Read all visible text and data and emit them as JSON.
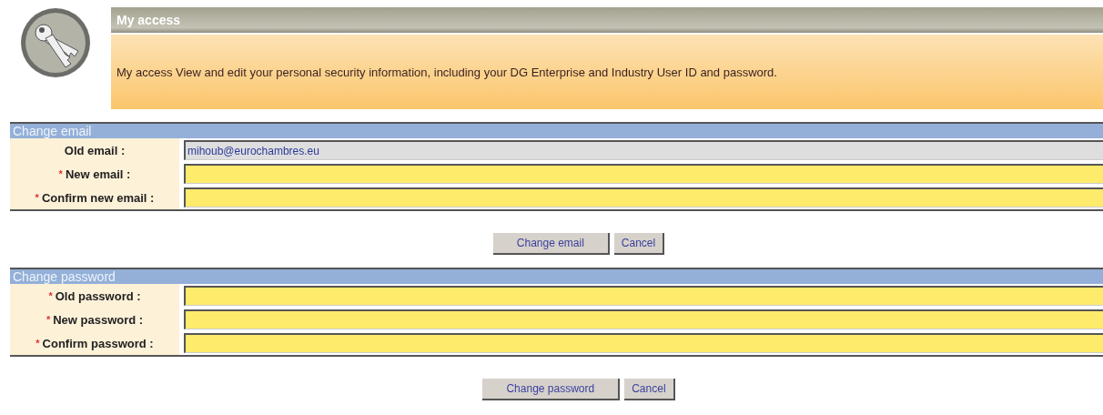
{
  "header": {
    "title": "My access",
    "description": "My access View and edit your personal security information, including your DG Enterprise and Industry User ID and password."
  },
  "sections": [
    {
      "title": "Change email",
      "fields": [
        {
          "label": "Old email :",
          "readonly": true,
          "value": "mihoub@eurochambres.eu"
        },
        {
          "required_mark": "*",
          "label": "New email :",
          "readonly": false
        },
        {
          "required_mark": "*",
          "label": "Confirm new email :",
          "readonly": false
        }
      ],
      "buttons": [
        {
          "label": "Change email",
          "kind": "primary"
        },
        {
          "label": "Cancel",
          "kind": "secondary"
        }
      ]
    },
    {
      "title": "Change password",
      "fields": [
        {
          "required_mark": "*",
          "label": "Old password :",
          "readonly": false
        },
        {
          "required_mark": "*",
          "label": "New password :",
          "readonly": false
        },
        {
          "required_mark": "*",
          "label": "Confirm password :",
          "readonly": false
        }
      ],
      "buttons": [
        {
          "label": "Change password",
          "kind": "primary"
        },
        {
          "label": "Cancel",
          "kind": "secondary"
        }
      ]
    }
  ]
}
